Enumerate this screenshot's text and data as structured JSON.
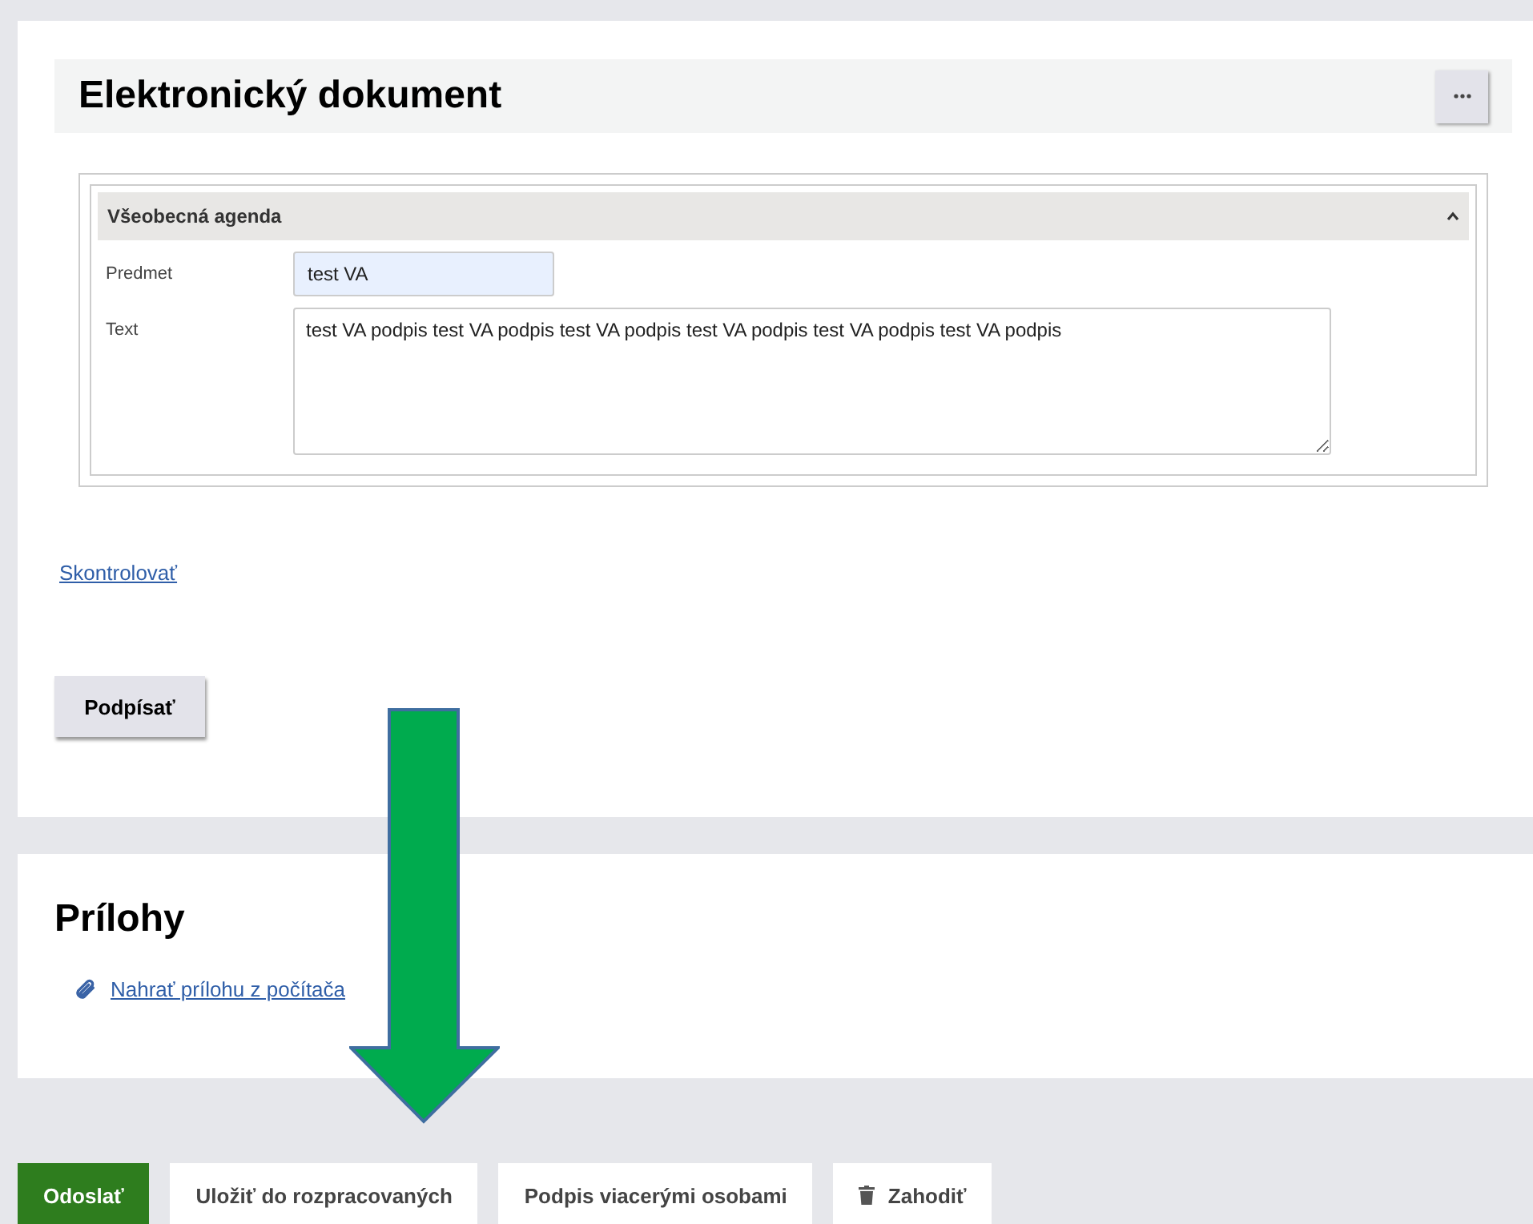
{
  "document": {
    "title": "Elektronický dokument",
    "section": {
      "title": "Všeobecná agenda",
      "expanded": true,
      "fields": [
        {
          "label": "Predmet",
          "kind": "input",
          "value": "test VA"
        },
        {
          "label": "Text",
          "kind": "textarea",
          "value": "test VA podpis test VA podpis test VA podpis test VA podpis test VA podpis test VA podpis"
        }
      ]
    },
    "check_link": "Skontrolovať",
    "sign_button": "Podpísať"
  },
  "attachments": {
    "title": "Prílohy",
    "upload_link": "Nahrať prílohu z počítača"
  },
  "buttons": [
    {
      "label": "Odoslať",
      "kind": "primary"
    },
    {
      "label": "Uložiť do rozpracovaných",
      "kind": "default"
    },
    {
      "label": "Podpis viacerými osobami",
      "kind": "default"
    },
    {
      "label": "Zahodiť",
      "kind": "delete"
    }
  ]
}
